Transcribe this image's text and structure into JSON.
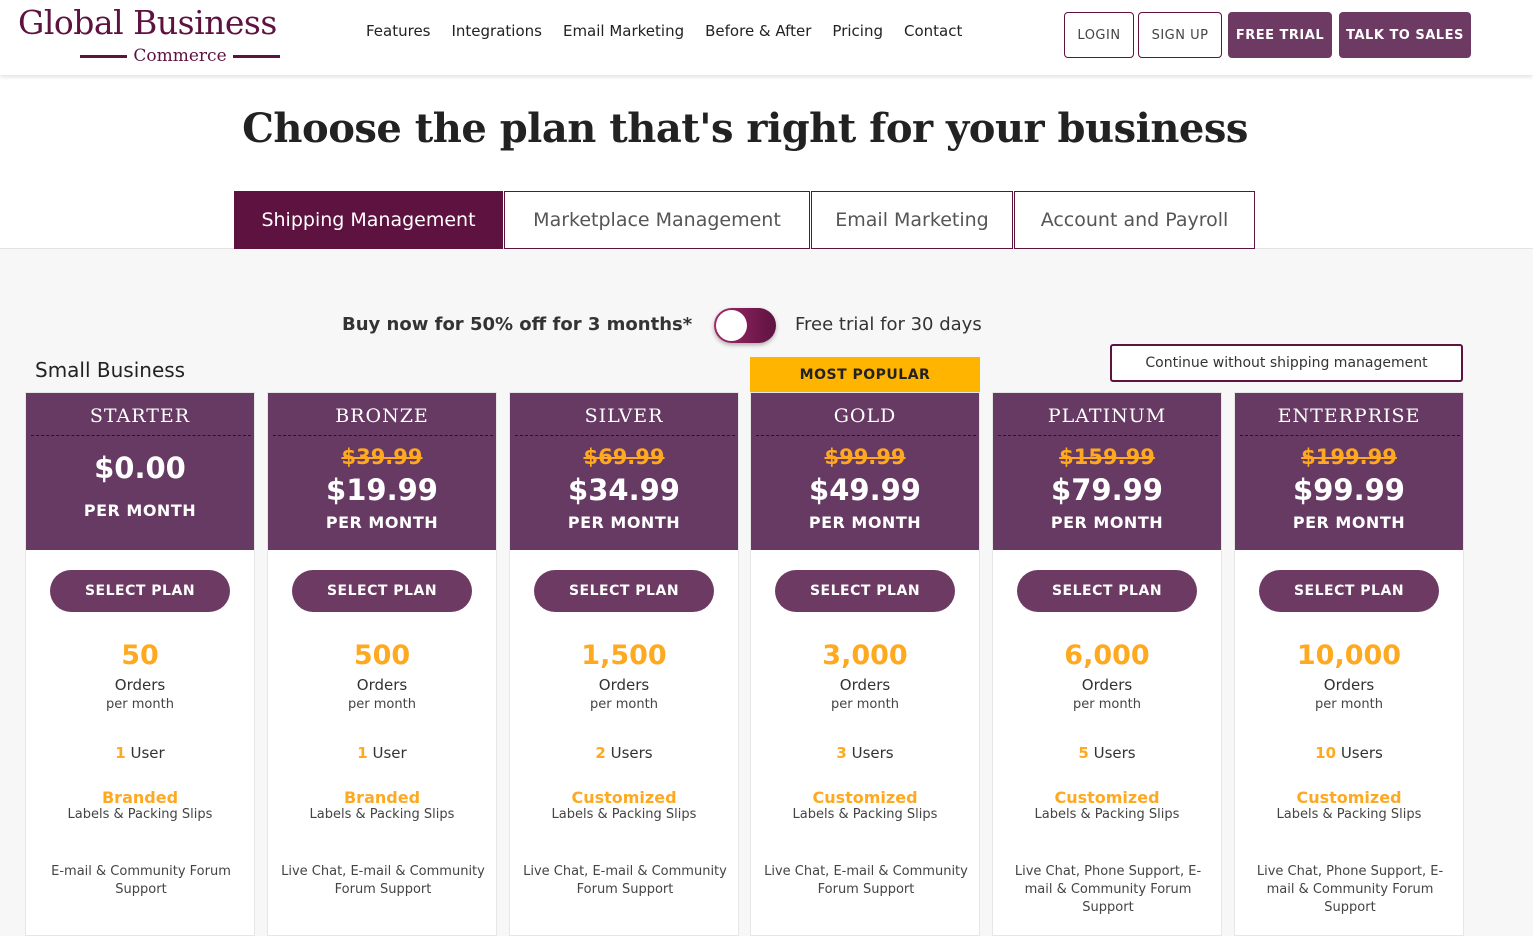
{
  "brand": {
    "name": "Global Business",
    "sub": "Commerce"
  },
  "nav": [
    "Features",
    "Integrations",
    "Email Marketing",
    "Before & After",
    "Pricing",
    "Contact"
  ],
  "header_buttons": {
    "login": "LOGIN",
    "signup": "SIGN UP",
    "free_trial": "FREE TRIAL",
    "talk_sales": "TALK TO SALES"
  },
  "page_title": "Choose the plan that's right for your business",
  "tabs": [
    {
      "label": "Shipping Management",
      "active": true
    },
    {
      "label": "Marketplace Management",
      "active": false
    },
    {
      "label": "Email Marketing",
      "active": false
    },
    {
      "label": "Account and Payroll",
      "active": false
    }
  ],
  "billing": {
    "promo": "Buy now for 50% off for 3 months*",
    "trial": "Free trial for 30 days",
    "toggle_on_trial": false
  },
  "segment_label": "Small Business",
  "continue_label": "Continue without shipping management",
  "popular_badge": "MOST POPULAR",
  "select_label": "SELECT PLAN",
  "per_month": "PER MONTH",
  "orders_label": "Orders",
  "per_month_lower": "per month",
  "labels_text": "Labels & Packing Slips",
  "plans": [
    {
      "name": "STARTER",
      "old": "",
      "price": "$0.00",
      "orders": "50",
      "users_n": "1",
      "users_w": " User",
      "labels": "Branded",
      "support": "E-mail & Community Forum Support"
    },
    {
      "name": "BRONZE",
      "old": "$39.99",
      "price": "$19.99",
      "orders": "500",
      "users_n": "1",
      "users_w": " User",
      "labels": "Branded",
      "support": "Live Chat, E-mail & Community Forum Support"
    },
    {
      "name": "SILVER",
      "old": "$69.99",
      "price": "$34.99",
      "orders": "1,500",
      "users_n": "2",
      "users_w": " Users",
      "labels": "Customized",
      "support": "Live Chat, E-mail & Community Forum Support"
    },
    {
      "name": "GOLD",
      "old": "$99.99",
      "price": "$49.99",
      "orders": "3,000",
      "users_n": "3",
      "users_w": " Users",
      "labels": "Customized",
      "support": "Live Chat, E-mail & Community Forum Support"
    },
    {
      "name": "PLATINUM",
      "old": "$159.99",
      "price": "$79.99",
      "orders": "6,000",
      "users_n": "5",
      "users_w": " Users",
      "labels": "Customized",
      "support": "Live Chat, Phone Support, E-mail & Community Forum Support"
    },
    {
      "name": "ENTERPRISE",
      "old": "$199.99",
      "price": "$99.99",
      "orders": "10,000",
      "users_n": "10",
      "users_w": " Users",
      "labels": "Customized",
      "support": "Live Chat, Phone Support, E-mail & Community Forum Support"
    }
  ],
  "colors": {
    "brand": "#5e1240",
    "card_head": "#663a63",
    "button": "#6d3a63",
    "accent": "#ffa920",
    "badge": "#ffb400"
  }
}
